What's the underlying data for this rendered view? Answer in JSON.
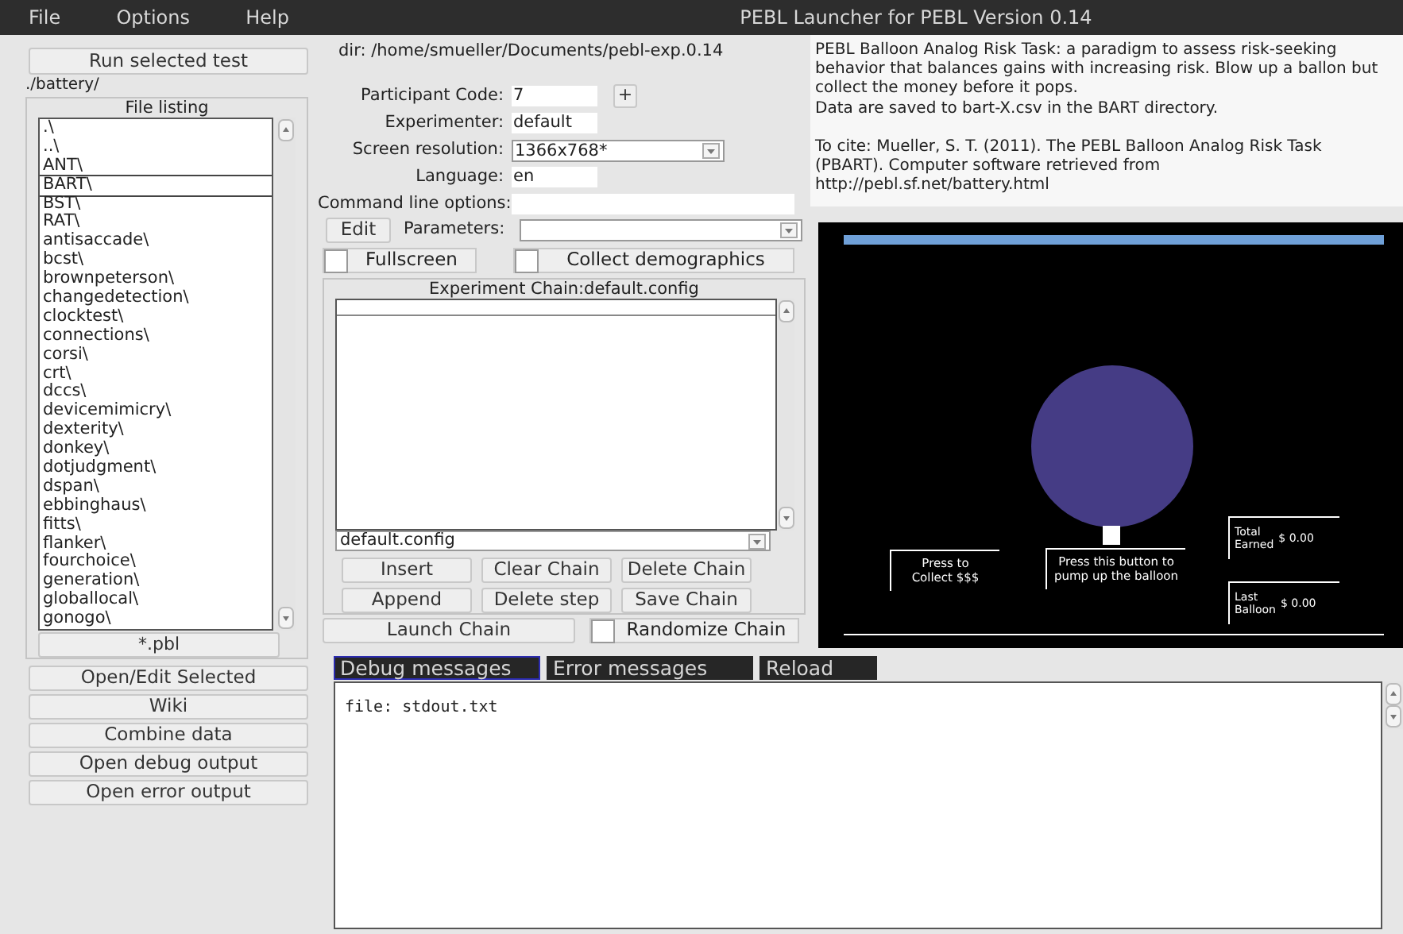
{
  "menu": [
    {
      "label": "File"
    },
    {
      "label": "Options"
    },
    {
      "label": "Help"
    }
  ],
  "window_title": "PEBL Launcher for PEBL Version 0.14",
  "run_button": "Run selected test",
  "path": "./battery/",
  "file_listing": {
    "title": "File listing",
    "filter_button": "*.pbl",
    "items": [
      {
        "label": ".\\",
        "selected": false
      },
      {
        "label": "..\\",
        "selected": false
      },
      {
        "label": "ANT\\",
        "selected": false
      },
      {
        "label": "BART\\",
        "selected": true
      },
      {
        "label": "BST\\",
        "selected": false
      },
      {
        "label": "RAT\\",
        "selected": false
      },
      {
        "label": "antisaccade\\",
        "selected": false
      },
      {
        "label": "bcst\\",
        "selected": false
      },
      {
        "label": "brownpeterson\\",
        "selected": false
      },
      {
        "label": "changedetection\\",
        "selected": false
      },
      {
        "label": "clocktest\\",
        "selected": false
      },
      {
        "label": "connections\\",
        "selected": false
      },
      {
        "label": "corsi\\",
        "selected": false
      },
      {
        "label": "crt\\",
        "selected": false
      },
      {
        "label": "dccs\\",
        "selected": false
      },
      {
        "label": "devicemimicry\\",
        "selected": false
      },
      {
        "label": "dexterity\\",
        "selected": false
      },
      {
        "label": "donkey\\",
        "selected": false
      },
      {
        "label": "dotjudgment\\",
        "selected": false
      },
      {
        "label": "dspan\\",
        "selected": false
      },
      {
        "label": "ebbinghaus\\",
        "selected": false
      },
      {
        "label": "fitts\\",
        "selected": false
      },
      {
        "label": "flanker\\",
        "selected": false
      },
      {
        "label": "fourchoice\\",
        "selected": false
      },
      {
        "label": "generation\\",
        "selected": false
      },
      {
        "label": "globallocal\\",
        "selected": false
      },
      {
        "label": "gonogo\\",
        "selected": false
      }
    ]
  },
  "side_buttons": [
    "Open/Edit Selected",
    "Wiki",
    "Combine data",
    "Open debug output",
    "Open error output"
  ],
  "dir": "dir: /home/smueller/Documents/pebl-exp.0.14",
  "fields": [
    {
      "label": "Participant Code:",
      "value": "7",
      "kind": "short",
      "button": "+"
    },
    {
      "label": "Experimenter:",
      "value": "default",
      "kind": "short"
    },
    {
      "label": "Screen resolution:",
      "value": "1366x768*",
      "kind": "select"
    },
    {
      "label": "Language:",
      "value": "en",
      "kind": "short"
    },
    {
      "label": "Command line options:",
      "kind": "wide"
    }
  ],
  "edit_button": "Edit",
  "parameters_label": "Parameters:",
  "options": [
    {
      "label": "Fullscreen",
      "checked": false
    },
    {
      "label": "Collect demographics",
      "checked": false
    }
  ],
  "chain": {
    "title": "Experiment Chain:default.config",
    "config": "default.config",
    "buttons": [
      "Insert",
      "Clear Chain",
      "Delete Chain",
      "Append",
      "Delete step",
      "Save Chain"
    ],
    "launch": "Launch Chain",
    "randomize": {
      "label": "Randomize Chain",
      "checked": false
    }
  },
  "description": "PEBL Balloon Analog Risk Task: a paradigm to assess risk-seeking\nbehavior that balances gains with increasing risk. Blow up a ballon but\ncollect the money before it pops.\nData are saved to bart-X.csv in the BART directory.\n\nTo cite:  Mueller, S. T. (2011). The PEBL Balloon Analog Risk Task\n(PBART).  Computer software retrieved from\nhttp://pebl.sf.net/battery.html",
  "preview": {
    "collect": "Press to\nCollect $$$",
    "pump": "Press this button to\npump up the balloon",
    "stats": [
      {
        "label": "Total\nEarned",
        "value": "$ 0.00"
      },
      {
        "label": "Last\nBalloon",
        "value": "$ 0.00"
      }
    ]
  },
  "tabs": [
    {
      "label": "Debug messages",
      "selected": true
    },
    {
      "label": "Error messages",
      "selected": false
    },
    {
      "label": "Reload",
      "selected": false
    }
  ],
  "log": "file: stdout.txt"
}
